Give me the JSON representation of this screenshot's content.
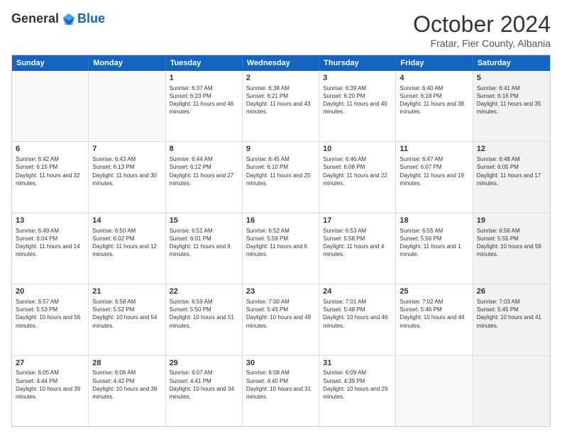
{
  "header": {
    "logo_general": "General",
    "logo_blue": "Blue",
    "month_title": "October 2024",
    "subtitle": "Fratar, Fier County, Albania"
  },
  "days_of_week": [
    "Sunday",
    "Monday",
    "Tuesday",
    "Wednesday",
    "Thursday",
    "Friday",
    "Saturday"
  ],
  "weeks": [
    [
      {
        "day": "",
        "info": "",
        "shaded": false,
        "empty": true
      },
      {
        "day": "",
        "info": "",
        "shaded": false,
        "empty": true
      },
      {
        "day": "1",
        "info": "Sunrise: 6:37 AM\nSunset: 6:23 PM\nDaylight: 11 hours and 46 minutes.",
        "shaded": false,
        "empty": false
      },
      {
        "day": "2",
        "info": "Sunrise: 6:38 AM\nSunset: 6:21 PM\nDaylight: 11 hours and 43 minutes.",
        "shaded": false,
        "empty": false
      },
      {
        "day": "3",
        "info": "Sunrise: 6:39 AM\nSunset: 6:20 PM\nDaylight: 11 hours and 40 minutes.",
        "shaded": false,
        "empty": false
      },
      {
        "day": "4",
        "info": "Sunrise: 6:40 AM\nSunset: 6:18 PM\nDaylight: 11 hours and 38 minutes.",
        "shaded": false,
        "empty": false
      },
      {
        "day": "5",
        "info": "Sunrise: 6:41 AM\nSunset: 6:16 PM\nDaylight: 11 hours and 35 minutes.",
        "shaded": true,
        "empty": false
      }
    ],
    [
      {
        "day": "6",
        "info": "Sunrise: 6:42 AM\nSunset: 6:15 PM\nDaylight: 11 hours and 32 minutes.",
        "shaded": false,
        "empty": false
      },
      {
        "day": "7",
        "info": "Sunrise: 6:43 AM\nSunset: 6:13 PM\nDaylight: 11 hours and 30 minutes.",
        "shaded": false,
        "empty": false
      },
      {
        "day": "8",
        "info": "Sunrise: 6:44 AM\nSunset: 6:12 PM\nDaylight: 11 hours and 27 minutes.",
        "shaded": false,
        "empty": false
      },
      {
        "day": "9",
        "info": "Sunrise: 6:45 AM\nSunset: 6:10 PM\nDaylight: 11 hours and 25 minutes.",
        "shaded": false,
        "empty": false
      },
      {
        "day": "10",
        "info": "Sunrise: 6:46 AM\nSunset: 6:08 PM\nDaylight: 11 hours and 22 minutes.",
        "shaded": false,
        "empty": false
      },
      {
        "day": "11",
        "info": "Sunrise: 6:47 AM\nSunset: 6:07 PM\nDaylight: 11 hours and 19 minutes.",
        "shaded": false,
        "empty": false
      },
      {
        "day": "12",
        "info": "Sunrise: 6:48 AM\nSunset: 6:05 PM\nDaylight: 11 hours and 17 minutes.",
        "shaded": true,
        "empty": false
      }
    ],
    [
      {
        "day": "13",
        "info": "Sunrise: 6:49 AM\nSunset: 6:04 PM\nDaylight: 11 hours and 14 minutes.",
        "shaded": false,
        "empty": false
      },
      {
        "day": "14",
        "info": "Sunrise: 6:50 AM\nSunset: 6:02 PM\nDaylight: 11 hours and 12 minutes.",
        "shaded": false,
        "empty": false
      },
      {
        "day": "15",
        "info": "Sunrise: 6:51 AM\nSunset: 6:01 PM\nDaylight: 11 hours and 9 minutes.",
        "shaded": false,
        "empty": false
      },
      {
        "day": "16",
        "info": "Sunrise: 6:52 AM\nSunset: 5:59 PM\nDaylight: 11 hours and 6 minutes.",
        "shaded": false,
        "empty": false
      },
      {
        "day": "17",
        "info": "Sunrise: 6:53 AM\nSunset: 5:58 PM\nDaylight: 11 hours and 4 minutes.",
        "shaded": false,
        "empty": false
      },
      {
        "day": "18",
        "info": "Sunrise: 6:55 AM\nSunset: 5:56 PM\nDaylight: 11 hours and 1 minute.",
        "shaded": false,
        "empty": false
      },
      {
        "day": "19",
        "info": "Sunrise: 6:56 AM\nSunset: 5:55 PM\nDaylight: 10 hours and 59 minutes.",
        "shaded": true,
        "empty": false
      }
    ],
    [
      {
        "day": "20",
        "info": "Sunrise: 6:57 AM\nSunset: 5:53 PM\nDaylight: 10 hours and 56 minutes.",
        "shaded": false,
        "empty": false
      },
      {
        "day": "21",
        "info": "Sunrise: 6:58 AM\nSunset: 5:52 PM\nDaylight: 10 hours and 54 minutes.",
        "shaded": false,
        "empty": false
      },
      {
        "day": "22",
        "info": "Sunrise: 6:59 AM\nSunset: 5:50 PM\nDaylight: 10 hours and 51 minutes.",
        "shaded": false,
        "empty": false
      },
      {
        "day": "23",
        "info": "Sunrise: 7:00 AM\nSunset: 5:49 PM\nDaylight: 10 hours and 49 minutes.",
        "shaded": false,
        "empty": false
      },
      {
        "day": "24",
        "info": "Sunrise: 7:01 AM\nSunset: 5:48 PM\nDaylight: 10 hours and 46 minutes.",
        "shaded": false,
        "empty": false
      },
      {
        "day": "25",
        "info": "Sunrise: 7:02 AM\nSunset: 5:46 PM\nDaylight: 10 hours and 44 minutes.",
        "shaded": false,
        "empty": false
      },
      {
        "day": "26",
        "info": "Sunrise: 7:03 AM\nSunset: 5:45 PM\nDaylight: 10 hours and 41 minutes.",
        "shaded": true,
        "empty": false
      }
    ],
    [
      {
        "day": "27",
        "info": "Sunrise: 6:05 AM\nSunset: 4:44 PM\nDaylight: 10 hours and 39 minutes.",
        "shaded": false,
        "empty": false
      },
      {
        "day": "28",
        "info": "Sunrise: 6:06 AM\nSunset: 4:42 PM\nDaylight: 10 hours and 36 minutes.",
        "shaded": false,
        "empty": false
      },
      {
        "day": "29",
        "info": "Sunrise: 6:07 AM\nSunset: 4:41 PM\nDaylight: 10 hours and 34 minutes.",
        "shaded": false,
        "empty": false
      },
      {
        "day": "30",
        "info": "Sunrise: 6:08 AM\nSunset: 4:40 PM\nDaylight: 10 hours and 31 minutes.",
        "shaded": false,
        "empty": false
      },
      {
        "day": "31",
        "info": "Sunrise: 6:09 AM\nSunset: 4:39 PM\nDaylight: 10 hours and 29 minutes.",
        "shaded": false,
        "empty": false
      },
      {
        "day": "",
        "info": "",
        "shaded": false,
        "empty": true
      },
      {
        "day": "",
        "info": "",
        "shaded": true,
        "empty": true
      }
    ]
  ]
}
